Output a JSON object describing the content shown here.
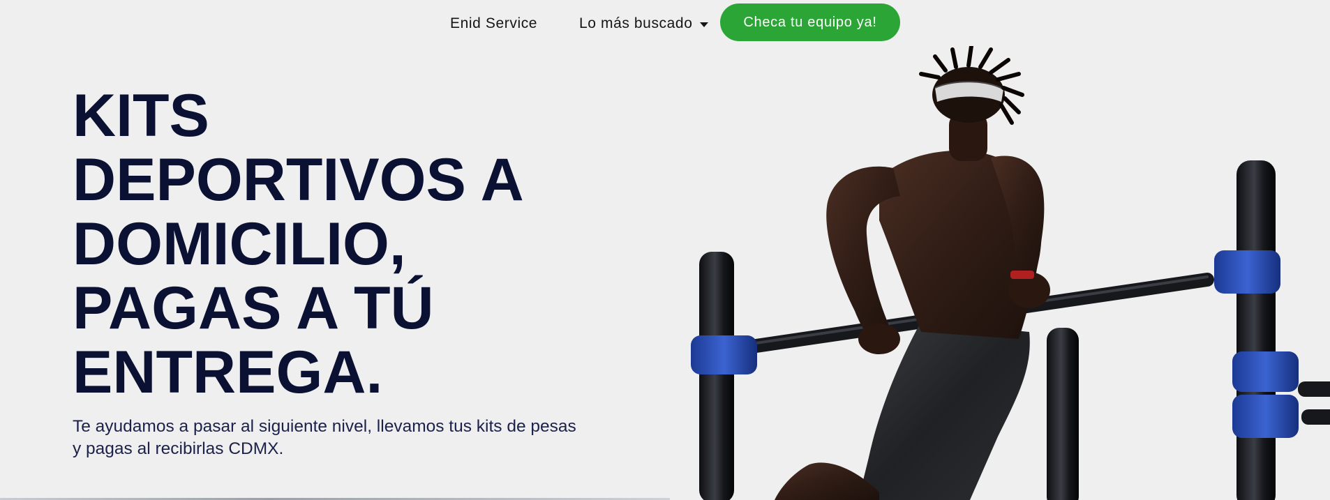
{
  "nav": {
    "links": [
      {
        "label": "Enid Service"
      },
      {
        "label": "Lo más buscado"
      }
    ],
    "cta_label": "Checa tu equipo ya!"
  },
  "hero": {
    "headline_lines": [
      "KITS",
      "DEPORTIVOS A",
      "DOMICILIO,",
      "PAGAS A TÚ",
      "ENTREGA."
    ],
    "subcopy_lines": [
      "Te ayudamos a pasar al siguiente nivel, llevamos tus kits de pesas",
      "y pagas al recibirlas CDMX."
    ]
  },
  "colors": {
    "background": "#efeff0",
    "headline": "#0b1133",
    "cta": "#2ba636",
    "bar_clamp": "#2a4db3"
  },
  "icons": {
    "dropdown": "chevron-down-icon"
  }
}
